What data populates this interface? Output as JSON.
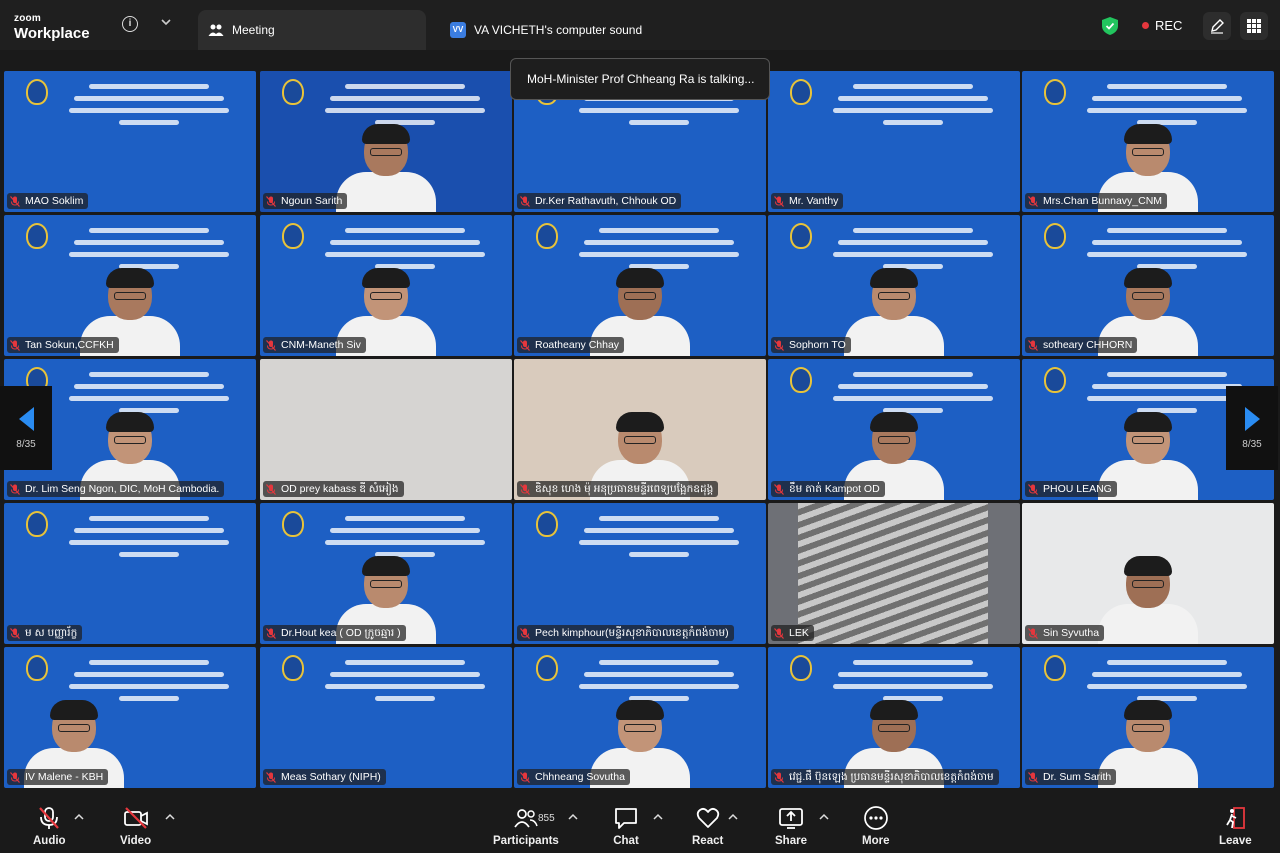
{
  "app": {
    "brand_top": "zoom",
    "brand_bottom": "Workplace"
  },
  "tabs": [
    {
      "label": "Meeting",
      "icon": "people-icon"
    },
    {
      "label": "VA VICHETH's computer sound",
      "icon": "vv-avatar",
      "avatar_text": "VV"
    }
  ],
  "status": {
    "rec_label": "REC",
    "rec_color": "#e5373d",
    "secure_color": "#22c55e"
  },
  "speaking_banner": "MoH-Minister Prof Chheang Ra is talking...",
  "pager": {
    "left_count": "8/35",
    "right_count": "8/35"
  },
  "participants_tiles": [
    {
      "name": "MAO Soklim",
      "bg": "blue",
      "person": false
    },
    {
      "name": "Ngoun Sarith",
      "bg": "dark",
      "person": true
    },
    {
      "name": "Dr.Ker Rathavuth, Chhouk OD",
      "bg": "blue",
      "person": false
    },
    {
      "name": "Mr. Vanthy",
      "bg": "blue",
      "person": false
    },
    {
      "name": "Mrs.Chan Bunnavy_CNM",
      "bg": "blue",
      "person": true
    },
    {
      "name": "Tan Sokun,CCFKH",
      "bg": "blue",
      "person": true
    },
    {
      "name": "CNM-Maneth Siv",
      "bg": "blue",
      "person": true
    },
    {
      "name": "Roatheany Chhay",
      "bg": "blue",
      "person": true
    },
    {
      "name": "Sophorn TO",
      "bg": "blue",
      "person": true
    },
    {
      "name": "sotheary CHHORN",
      "bg": "blue",
      "person": true
    },
    {
      "name": "Dr. Lim Seng Ngon, DIC, MoH Cambodia.",
      "bg": "blue",
      "person": true
    },
    {
      "name": "OD prey kabass ឌី សំអៀង",
      "bg": "gray",
      "person": false
    },
    {
      "name": "ឌិសុខ ហេង ម៉ុ អនុប្រធានមន្ទីរពេទ្យបង្អែកឧដុង្គ",
      "bg": "beige",
      "person": true
    },
    {
      "name": "ខឹម តាត់ Kampot OD",
      "bg": "blue",
      "person": true
    },
    {
      "name": "PHOU LEANG",
      "bg": "blue",
      "person": true
    },
    {
      "name": "ម ស បញ្ញារ័ក្ខ",
      "bg": "blue",
      "person": false
    },
    {
      "name": "Dr.Hout kea ( OD ក្រូចឆ្មារ )",
      "bg": "blue",
      "person": true
    },
    {
      "name": "Pech kimphour(មន្ទីរសុខាភិបាលខេត្តកំពង់ចាម)",
      "bg": "blue",
      "person": false
    },
    {
      "name": "LEK",
      "bg": "steel",
      "person": false
    },
    {
      "name": "Sin Syvutha",
      "bg": "room2",
      "person": true
    },
    {
      "name": "IV Malene - KBH",
      "bg": "blue",
      "person": true
    },
    {
      "name": "Meas Sothary (NIPH)",
      "bg": "blue",
      "person": false
    },
    {
      "name": "Chhneang Sovutha",
      "bg": "blue",
      "person": true
    },
    {
      "name": "វេជ្ជ.ផឹ ប៊ុនឡេង ប្រធានមន្ទីរសុខាភិបាលខេត្តកំពង់ចាម",
      "bg": "blue",
      "person": true
    },
    {
      "name": "Dr. Sum Sarith",
      "bg": "blue",
      "person": true
    }
  ],
  "toolbar": {
    "audio": "Audio",
    "video": "Video",
    "participants": "Participants",
    "participants_count": "855",
    "chat": "Chat",
    "react": "React",
    "share": "Share",
    "more": "More",
    "leave": "Leave"
  }
}
